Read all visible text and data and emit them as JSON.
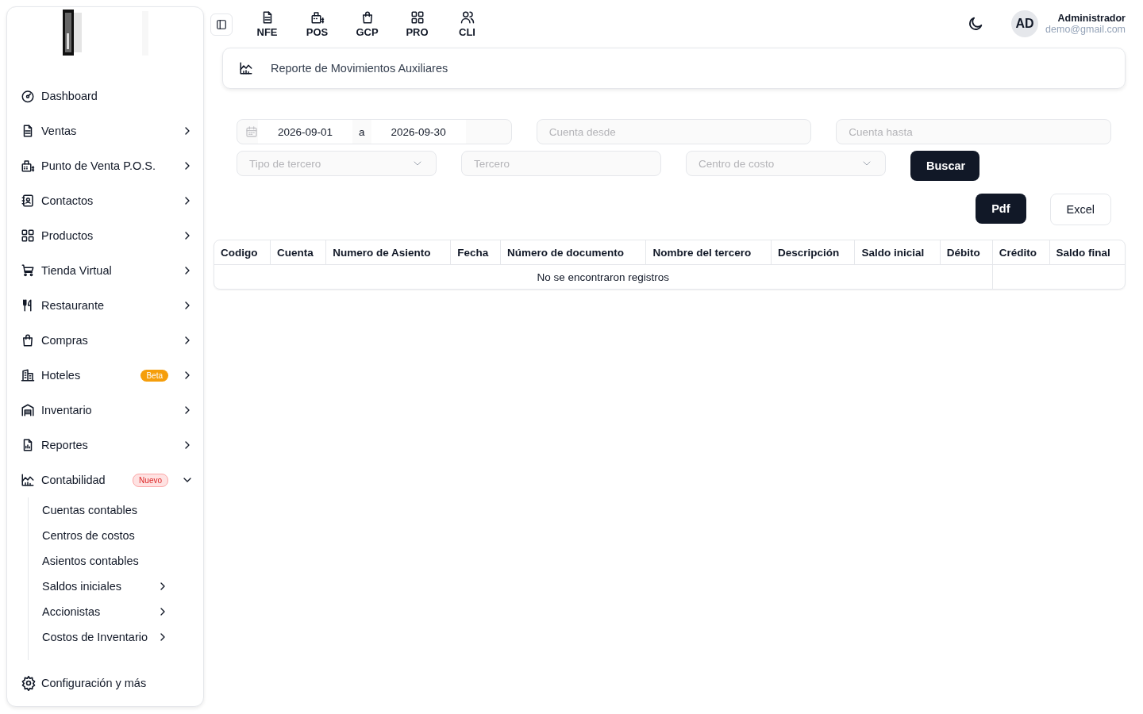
{
  "sidebar": {
    "items": [
      {
        "label": "Dashboard",
        "has_children": false
      },
      {
        "label": "Ventas",
        "has_children": true,
        "expanded": false
      },
      {
        "label": "Punto de Venta P.O.S.",
        "has_children": true,
        "expanded": false
      },
      {
        "label": "Contactos",
        "has_children": true,
        "expanded": false
      },
      {
        "label": "Productos",
        "has_children": true,
        "expanded": false
      },
      {
        "label": "Tienda Virtual",
        "has_children": true,
        "expanded": false
      },
      {
        "label": "Restaurante",
        "has_children": true,
        "expanded": false
      },
      {
        "label": "Compras",
        "has_children": true,
        "expanded": false
      },
      {
        "label": "Hoteles",
        "has_children": true,
        "expanded": false,
        "badge": {
          "label": "Beta",
          "kind": "beta"
        }
      },
      {
        "label": "Inventario",
        "has_children": true,
        "expanded": false
      },
      {
        "label": "Reportes",
        "has_children": true,
        "expanded": false
      },
      {
        "label": "Contabilidad",
        "has_children": true,
        "expanded": true,
        "badge": {
          "label": "Nuevo",
          "kind": "new"
        },
        "children": [
          {
            "label": "Cuentas contables",
            "has_children": false
          },
          {
            "label": "Centros de costos",
            "has_children": false
          },
          {
            "label": "Asientos contables",
            "has_children": false
          },
          {
            "label": "Saldos iniciales",
            "has_children": true
          },
          {
            "label": "Accionistas",
            "has_children": true
          },
          {
            "label": "Costos de Inventario",
            "has_children": true
          }
        ]
      }
    ],
    "footer": "Configuración y más"
  },
  "topbar": {
    "shortcuts": [
      "NFE",
      "POS",
      "GCP",
      "PRO",
      "CLI"
    ],
    "user": {
      "initials": "AD",
      "name": "Administrador",
      "email": "demo@gmail.com"
    }
  },
  "page_title": "Reporte de Movimientos Auxiliares",
  "filters": {
    "date_from": "2026-09-01",
    "date_separator": "a",
    "date_to": "2026-09-30",
    "account_from": {
      "placeholder": "Cuenta desde"
    },
    "account_to": {
      "placeholder": "Cuenta hasta"
    },
    "third_party_type": {
      "placeholder": "Tipo de tercero"
    },
    "third_party": {
      "placeholder": "Tercero"
    },
    "cost_center": {
      "placeholder": "Centro de costo"
    },
    "search_button": "Buscar"
  },
  "export_buttons": [
    "Pdf",
    "Excel"
  ],
  "table": {
    "columns": [
      "Codigo",
      "Cuenta",
      "Numero de Asiento",
      "Fecha",
      "Número de documento",
      "Nombre del tercero",
      "Descripción",
      "Saldo inicial",
      "Débito",
      "Crédito",
      "Saldo final"
    ],
    "empty_message": "No se encontraron registros"
  }
}
